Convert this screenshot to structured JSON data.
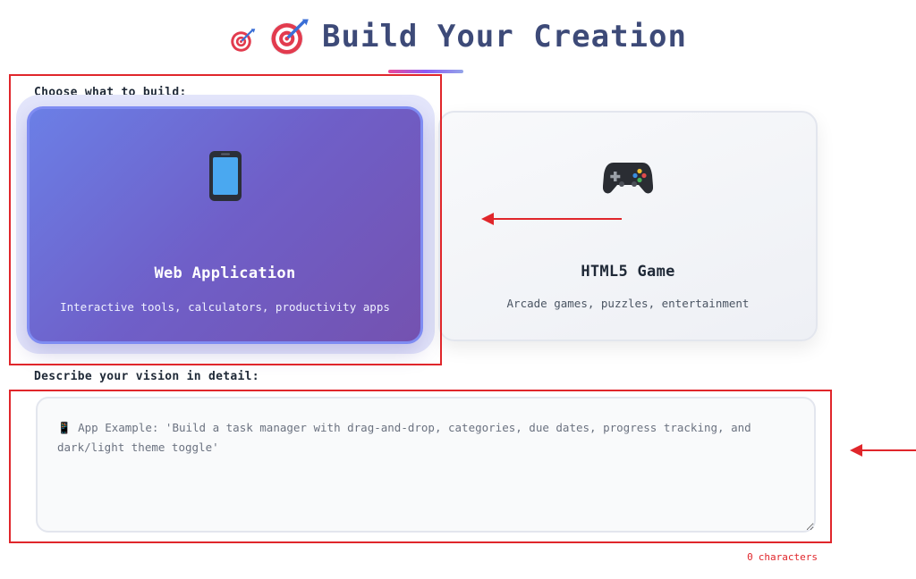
{
  "header": {
    "title": "Build Your Creation",
    "icon_small": "dart-target-icon",
    "icon_large": "dart-target-icon"
  },
  "labels": {
    "choose": "Choose what to build:",
    "describe": "Describe your vision in detail:"
  },
  "options": [
    {
      "icon": "mobile-phone-icon",
      "title": "Web Application",
      "description": "Interactive tools, calculators, productivity apps",
      "selected": true
    },
    {
      "icon": "game-controller-icon",
      "title": "HTML5 Game",
      "description": "Arcade games, puzzles, entertainment",
      "selected": false
    }
  ],
  "textarea": {
    "value": "",
    "placeholder": "📱 App Example: 'Build a task manager with drag-and-drop, categories, due dates, progress tracking, and dark/light theme toggle'"
  },
  "char_count": {
    "value": "0",
    "unit": "characters"
  },
  "colors": {
    "accent": "#6f5fc8",
    "title": "#3d4a78",
    "annotation": "#e0262b"
  }
}
